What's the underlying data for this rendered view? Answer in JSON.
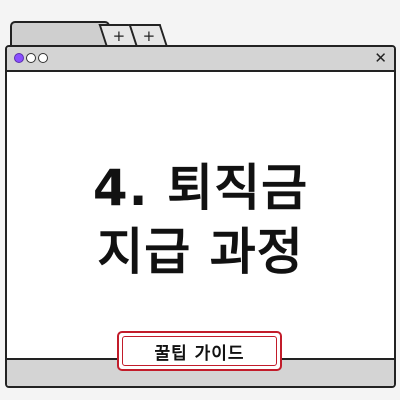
{
  "tabs": {
    "new_tab_labels": [
      "+",
      "+"
    ]
  },
  "window": {
    "close_glyph": "✕",
    "controls": {
      "colors": {
        "dot_primary": "#8a4fff"
      }
    }
  },
  "content": {
    "headline_line1": "4. 퇴직금",
    "headline_line2": "지급 과정"
  },
  "badge": {
    "label": "꿀팁 가이드",
    "border_color": "#c21c2a"
  }
}
